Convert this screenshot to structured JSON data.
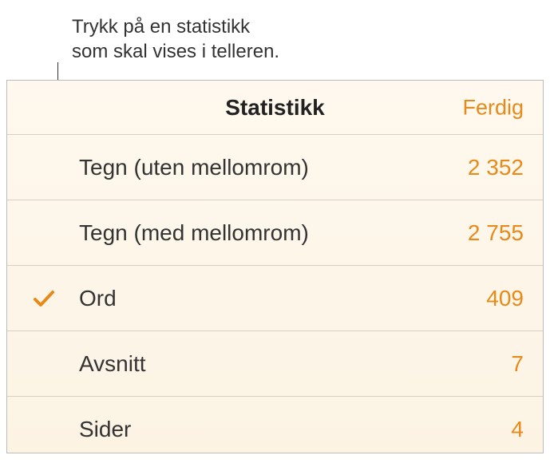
{
  "callout": {
    "text": "Trykk på en statistikk\nsom skal vises i telleren."
  },
  "panel": {
    "title": "Statistikk",
    "done_label": "Ferdig",
    "stats": [
      {
        "label": "Tegn (uten mellomrom)",
        "value": "2 352",
        "selected": false
      },
      {
        "label": "Tegn (med mellomrom)",
        "value": "2 755",
        "selected": false
      },
      {
        "label": "Ord",
        "value": "409",
        "selected": true
      },
      {
        "label": "Avsnitt",
        "value": "7",
        "selected": false
      },
      {
        "label": "Sider",
        "value": "4",
        "selected": false
      }
    ]
  }
}
